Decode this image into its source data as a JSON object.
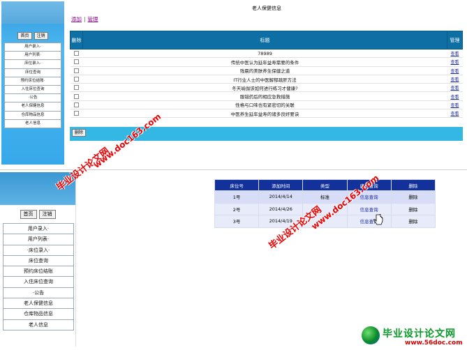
{
  "top": {
    "page_title": "老人保健信息",
    "add_link": "添加",
    "separator": "|",
    "manage_link": "管理",
    "buttons": {
      "home": "首页",
      "logout": "注销",
      "delete": "删除"
    },
    "menu": [
      "用户录入·",
      "用户列表·",
      "床位录入·",
      "床位查询",
      "预约床位结账·",
      "入住床位查询",
      "·公告",
      "老人保健信息",
      "仓库物品信息",
      "老人信息"
    ],
    "table": {
      "headers": {
        "delete": "删除",
        "title": "标题",
        "manage": "管理"
      },
      "rows": [
        {
          "title": "78989",
          "action": "查看"
        },
        {
          "title": "传统中医认为延年益寿需要的条件",
          "action": "查看"
        },
        {
          "title": "残晨的美肤养生保健之道",
          "action": "查看"
        },
        {
          "title": "IT行业人士的中医解郁疏肝方法",
          "action": "查看"
        },
        {
          "title": "冬天瑜伽该如何进行练习才健康?",
          "action": "查看"
        },
        {
          "title": "服错药后的相应急救措施",
          "action": "查看"
        },
        {
          "title": "性格与口味也有紧密切的关联",
          "action": "查看"
        },
        {
          "title": "中医养生延年益寿的诸多良好要诀",
          "action": "查看"
        }
      ]
    }
  },
  "bottom": {
    "buttons": {
      "home": "首页",
      "logout": "注销"
    },
    "menu": [
      "用户录入·",
      "用户列表·",
      "·床位录入·",
      "床位查询",
      "预约床位结账",
      "入住床位查询",
      "·公告",
      "老人保健信息",
      "仓库物品信息",
      "老人信息"
    ],
    "table": {
      "headers": [
        "床位号",
        "添加时间",
        "类型",
        "床位查询",
        "删除"
      ],
      "rows": [
        {
          "bed": "1号",
          "date": "2014/4/14",
          "type": "标准",
          "query": "信息查询",
          "delete": "删除"
        },
        {
          "bed": "2号",
          "date": "2014/4/26",
          "type": "",
          "query": "信息查询",
          "delete": "删除"
        },
        {
          "bed": "3号",
          "date": "2014/4/19",
          "type": "",
          "query": "信息查询",
          "delete": "删除"
        }
      ]
    }
  },
  "watermarks": {
    "cn": "毕业设计论文网",
    "url": "www.doc163.com",
    "logo_title": "毕业设计论文网",
    "logo_url": "www.56doc.com"
  }
}
